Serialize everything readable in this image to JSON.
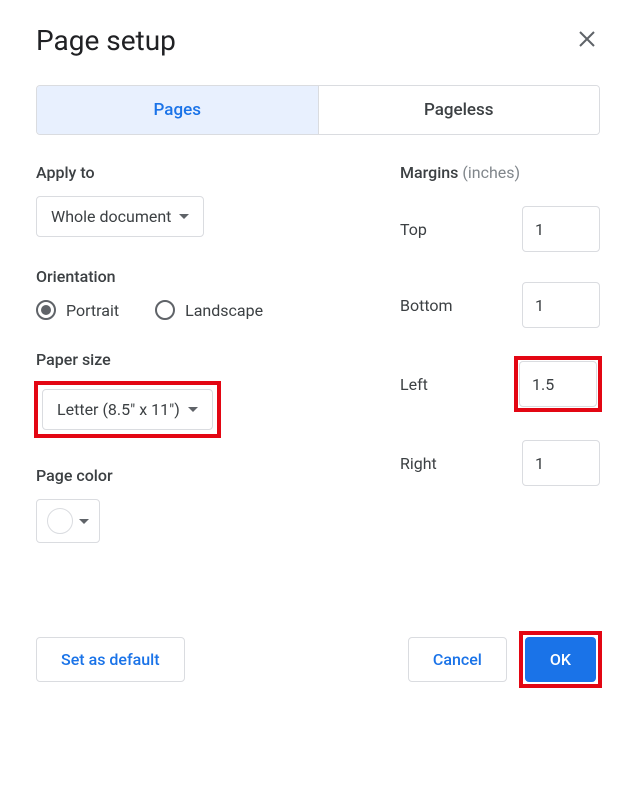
{
  "dialog": {
    "title": "Page setup"
  },
  "tabs": {
    "pages": "Pages",
    "pageless": "Pageless",
    "active": "pages"
  },
  "applyTo": {
    "label": "Apply to",
    "value": "Whole document"
  },
  "orientation": {
    "label": "Orientation",
    "portrait": "Portrait",
    "landscape": "Landscape",
    "selected": "portrait"
  },
  "paperSize": {
    "label": "Paper size",
    "value": "Letter (8.5\" x 11\")"
  },
  "pageColor": {
    "label": "Page color",
    "value": "#ffffff"
  },
  "margins": {
    "label": "Margins",
    "unit": "(inches)",
    "top": {
      "label": "Top",
      "value": "1"
    },
    "bottom": {
      "label": "Bottom",
      "value": "1"
    },
    "left": {
      "label": "Left",
      "value": "1.5"
    },
    "right": {
      "label": "Right",
      "value": "1"
    }
  },
  "buttons": {
    "setDefault": "Set as default",
    "cancel": "Cancel",
    "ok": "OK"
  },
  "highlights": {
    "paperSize": true,
    "marginLeft": true,
    "okButton": true
  }
}
